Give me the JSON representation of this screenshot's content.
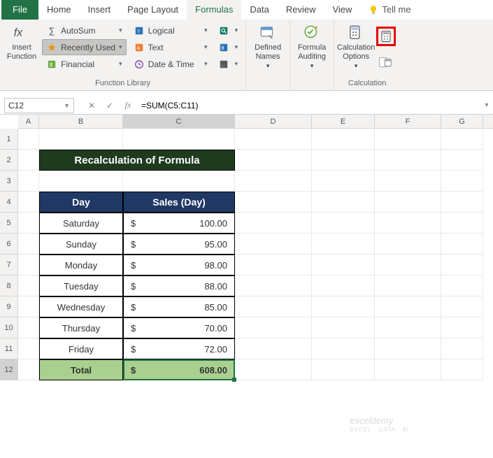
{
  "tabs": {
    "file": "File",
    "home": "Home",
    "insert": "Insert",
    "pagelayout": "Page Layout",
    "formulas": "Formulas",
    "data": "Data",
    "review": "Review",
    "view": "View",
    "tellme": "Tell me"
  },
  "ribbon": {
    "insertFunction": "Insert\nFunction",
    "lib": {
      "autosum": "AutoSum",
      "recently": "Recently Used",
      "financial": "Financial",
      "logical": "Logical",
      "text": "Text",
      "datetime": "Date & Time",
      "groupLabel": "Function Library"
    },
    "defined": {
      "label": "Defined\nNames"
    },
    "auditing": {
      "label": "Formula\nAuditing"
    },
    "calc": {
      "options": "Calculation\nOptions",
      "groupLabel": "Calculation"
    }
  },
  "nameBox": "C12",
  "formulaBar": "=SUM(C5:C11)",
  "columns": [
    "A",
    "B",
    "C",
    "D",
    "E",
    "F",
    "G"
  ],
  "rowCount": 12,
  "sheet": {
    "title": "Recalculation of Formula",
    "headers": {
      "day": "Day",
      "sales": "Sales (Day)"
    },
    "rows": [
      {
        "day": "Saturday",
        "cur": "$",
        "val": "100.00"
      },
      {
        "day": "Sunday",
        "cur": "$",
        "val": "95.00"
      },
      {
        "day": "Monday",
        "cur": "$",
        "val": "98.00"
      },
      {
        "day": "Tuesday",
        "cur": "$",
        "val": "88.00"
      },
      {
        "day": "Wednesday",
        "cur": "$",
        "val": "85.00"
      },
      {
        "day": "Thursday",
        "cur": "$",
        "val": "70.00"
      },
      {
        "day": "Friday",
        "cur": "$",
        "val": "72.00"
      }
    ],
    "total": {
      "label": "Total",
      "cur": "$",
      "val": "608.00"
    }
  },
  "watermark": {
    "main": "exceldemy",
    "sub": "EXCEL · DATA · BI"
  },
  "chart_data": {
    "type": "table",
    "title": "Recalculation of Formula",
    "categories": [
      "Saturday",
      "Sunday",
      "Monday",
      "Tuesday",
      "Wednesday",
      "Thursday",
      "Friday"
    ],
    "values": [
      100.0,
      95.0,
      98.0,
      88.0,
      85.0,
      70.0,
      72.0
    ],
    "total": 608.0,
    "ylabel": "Sales (Day)"
  }
}
